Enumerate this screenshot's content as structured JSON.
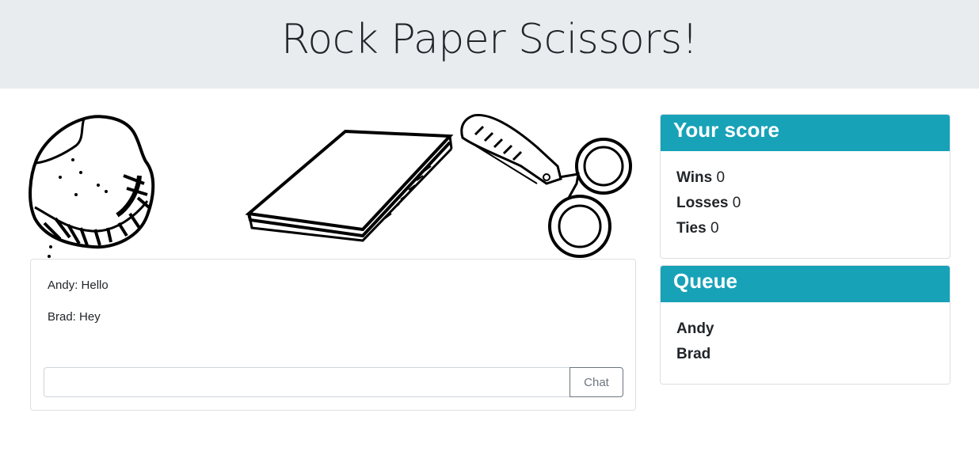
{
  "header": {
    "title": "Rock Paper Scissors!"
  },
  "choices": [
    {
      "name": "rock",
      "icon": "rock-drawing"
    },
    {
      "name": "paper",
      "icon": "paper-stack-drawing"
    },
    {
      "name": "scissors",
      "icon": "scissors-drawing"
    }
  ],
  "chat": {
    "messages": [
      "Andy: Hello",
      "Brad: Hey"
    ],
    "input_value": "",
    "button_label": "Chat"
  },
  "score": {
    "title": "Your score",
    "wins_label": "Wins",
    "wins": "0",
    "losses_label": "Losses",
    "losses": "0",
    "ties_label": "Ties",
    "ties": "0"
  },
  "queue": {
    "title": "Queue",
    "players": [
      "Andy",
      "Brad"
    ]
  },
  "colors": {
    "header_bg": "#e9ecef",
    "card_header_bg": "#17a2b8",
    "card_header_text": "#ffffff"
  }
}
